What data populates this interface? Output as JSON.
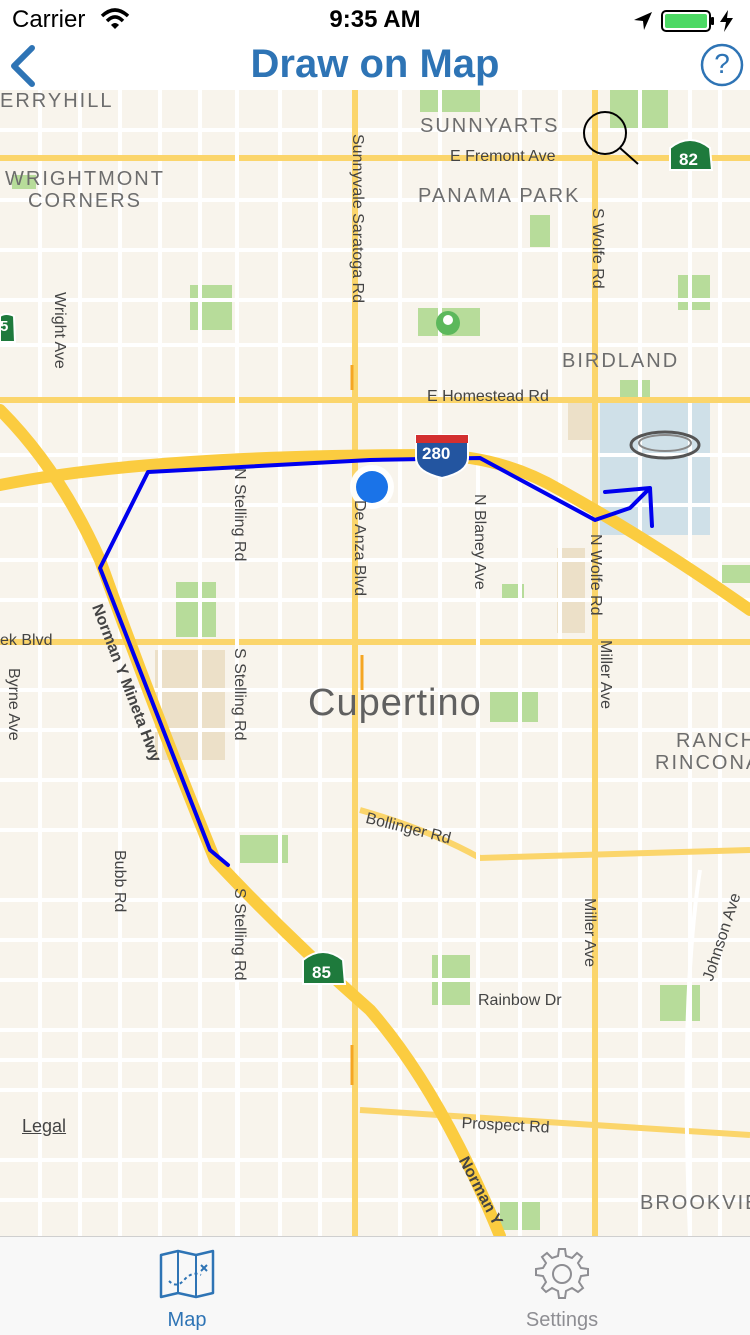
{
  "status_bar": {
    "carrier": "Carrier",
    "time": "9:35 AM",
    "icons": [
      "wifi-icon",
      "location-arrow-icon",
      "battery-icon",
      "charging-icon"
    ]
  },
  "nav": {
    "title": "Draw on Map",
    "back_icon": "chevron-left-icon",
    "help_label": "?"
  },
  "map": {
    "area_labels": [
      "ERRYHILL",
      "SUNNYARTS",
      "WRIGHTMONT",
      "CORNERS",
      "PANAMA PARK",
      "BIRDLAND",
      "RANCH",
      "RINCONA",
      "BROOKVIE"
    ],
    "road_labels": [
      "E Fremont Ave",
      "Sunnyvale Saratoga Rd",
      "S Wolfe Rd",
      "Wright Ave",
      "E Homestead Rd",
      "N Stelling Rd",
      "De Anza Blvd",
      "N Blaney Ave",
      "N Wolfe Rd",
      "Miller Ave",
      "ek Blvd",
      "Byrne Ave",
      "Norman Y Mineta Hwy",
      "S Stelling Rd",
      "Bollinger Rd",
      "Bubb Rd",
      "S Stelling Rd",
      "Miller Ave",
      "Johnson Ave",
      "Rainbow Dr",
      "Prospect Rd",
      "Norman Y"
    ],
    "city_label": "Cupertino",
    "shields": {
      "i280": "280",
      "ca82": "82",
      "ca85": "85",
      "ca_left": "5"
    },
    "legal": "Legal",
    "colors": {
      "land": "#f8f4ec",
      "road": "#ffffff",
      "arterial": "#fbd56b",
      "freeway": "#fbcc40",
      "park": "#b7dc9a",
      "water": "#cfe0e8",
      "route": "#0000ee",
      "user_location": "#1a73e8"
    }
  },
  "tabs": [
    {
      "label": "Map",
      "icon": "map-icon",
      "active": true
    },
    {
      "label": "Settings",
      "icon": "gear-icon",
      "active": false
    }
  ]
}
